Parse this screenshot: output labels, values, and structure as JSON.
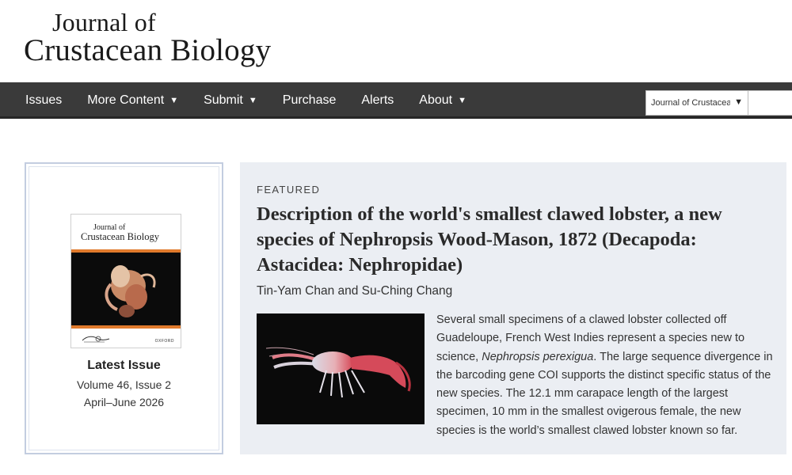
{
  "logo": {
    "line1": "Journal of",
    "line2": "Crustacean Biology"
  },
  "nav": {
    "items": [
      {
        "label": "Issues",
        "dropdown": false
      },
      {
        "label": "More Content",
        "dropdown": true
      },
      {
        "label": "Submit",
        "dropdown": true
      },
      {
        "label": "Purchase",
        "dropdown": false
      },
      {
        "label": "Alerts",
        "dropdown": false
      },
      {
        "label": "About",
        "dropdown": true
      }
    ],
    "caret": "▼",
    "search_scope": "Journal of Crustacea",
    "search_caret": "▼"
  },
  "latest_issue": {
    "cover_title_line1": "Journal of",
    "cover_title_line2": "Crustacean Biology",
    "cover_publisher": "OXFORD",
    "heading": "Latest Issue",
    "volume": "Volume 46, Issue 2",
    "date": "April–June 2026"
  },
  "featured": {
    "label": "FEATURED",
    "title": "Description of the world's smallest clawed lobster, a new species of Nephropsis Wood-Mason, 1872 (Decapoda: Astacidea: Nephropidae)",
    "authors": "Tin-Yam Chan and Su-Ching Chang",
    "abstract_before": "Several small specimens of a clawed lobster collected off Guadeloupe, French West Indies represent a species new to science, ",
    "abstract_species": "Nephropsis perexigua",
    "abstract_after": ". The large sequence divergence in the barcoding gene COI supports the distinct specific status of the new species. The 12.1 mm carapace length of the largest specimen, 10 mm in the smallest ovigerous female, the new species is the world’s smallest clawed lobster known so far."
  },
  "colors": {
    "navbar": "#3a3a3a",
    "featured_bg": "#ebeef3",
    "card_border": "#c3cde0",
    "cover_accent": "#e07a2c"
  }
}
